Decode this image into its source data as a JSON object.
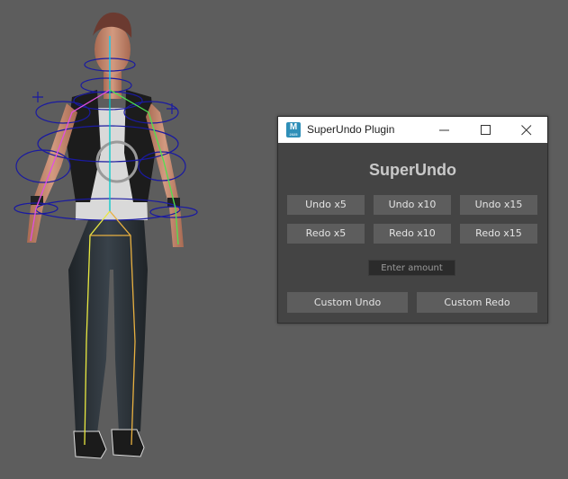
{
  "window": {
    "title": "SuperUndo Plugin",
    "icon": "maya-app-icon",
    "icon_letter": "M",
    "icon_sublabel": "2025",
    "controls": [
      "minimize-icon",
      "maximize-icon",
      "close-icon"
    ]
  },
  "plugin": {
    "heading": "SuperUndo",
    "undo_buttons": [
      "Undo x5",
      "Undo x10",
      "Undo x15"
    ],
    "redo_buttons": [
      "Redo x5",
      "Redo x10",
      "Redo x15"
    ],
    "amount_input": {
      "placeholder": "Enter amount",
      "value": ""
    },
    "custom_undo": "Custom Undo",
    "custom_redo": "Custom Redo"
  },
  "viewport": {
    "background_color": "#5d5d5d",
    "content": "rigged-character"
  },
  "colors": {
    "button_bg": "#5d5d5d",
    "window_bg": "#444444",
    "heading": "#c9c9c9",
    "rig_controls": "#1a1aa0"
  }
}
